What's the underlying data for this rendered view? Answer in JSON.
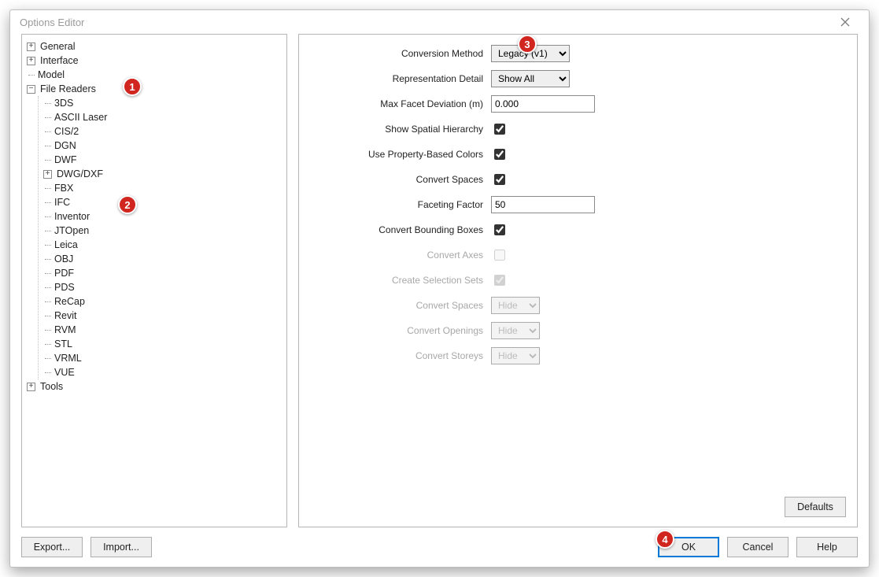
{
  "window": {
    "title": "Options Editor"
  },
  "tree": {
    "general": "General",
    "interface": "Interface",
    "model": "Model",
    "file_readers": "File Readers",
    "tools": "Tools",
    "readers": [
      "3DS",
      "ASCII Laser",
      "CIS/2",
      "DGN",
      "DWF",
      "DWG/DXF",
      "FBX",
      "IFC",
      "Inventor",
      "JTOpen",
      "Leica",
      "OBJ",
      "PDF",
      "PDS",
      "ReCap",
      "Revit",
      "RVM",
      "STL",
      "VRML",
      "VUE"
    ]
  },
  "form": {
    "conversion_method": {
      "label": "Conversion Method",
      "value": "Legacy (v1)"
    },
    "representation_detail": {
      "label": "Representation Detail",
      "value": "Show All"
    },
    "max_facet_deviation": {
      "label": "Max Facet Deviation (m)",
      "value": "0.000"
    },
    "show_spatial_hierarchy": {
      "label": "Show Spatial Hierarchy",
      "checked": true
    },
    "use_property_based_colors": {
      "label": "Use Property-Based Colors",
      "checked": true
    },
    "convert_spaces_chk": {
      "label": "Convert Spaces",
      "checked": true
    },
    "faceting_factor": {
      "label": "Faceting Factor",
      "value": "50"
    },
    "convert_bounding_boxes": {
      "label": "Convert Bounding Boxes",
      "checked": true
    },
    "convert_axes": {
      "label": "Convert Axes",
      "checked": false,
      "disabled": true
    },
    "create_selection_sets": {
      "label": "Create Selection Sets",
      "checked": true,
      "disabled": true
    },
    "convert_spaces_sel": {
      "label": "Convert Spaces",
      "value": "Hide",
      "disabled": true
    },
    "convert_openings": {
      "label": "Convert Openings",
      "value": "Hide",
      "disabled": true
    },
    "convert_storeys": {
      "label": "Convert Storeys",
      "value": "Hide",
      "disabled": true
    }
  },
  "buttons": {
    "export": "Export...",
    "import": "Import...",
    "defaults": "Defaults",
    "ok": "OK",
    "cancel": "Cancel",
    "help": "Help"
  },
  "annotations": {
    "a1": "1",
    "a2": "2",
    "a3": "3",
    "a4": "4"
  }
}
